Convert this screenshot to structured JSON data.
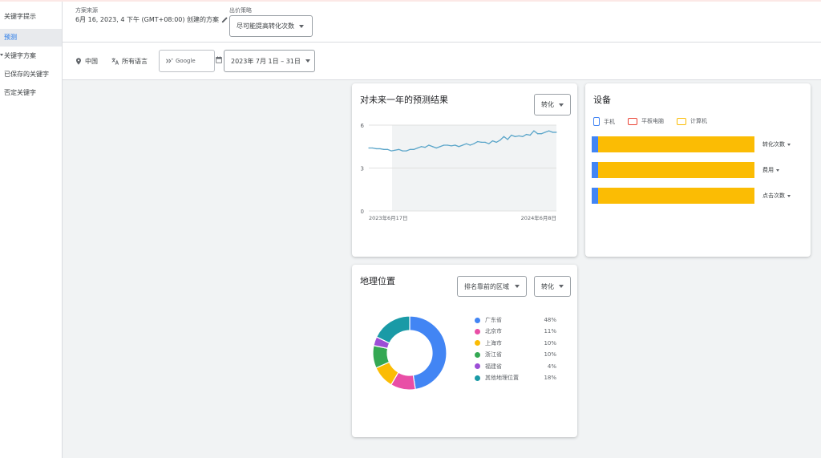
{
  "sidebar": {
    "items": [
      {
        "label": "关键字提示"
      },
      {
        "label": "预测"
      },
      {
        "label": "关键字方案"
      },
      {
        "label": "已保存的关键字"
      },
      {
        "label": "否定关键字"
      }
    ]
  },
  "plan": {
    "source_label": "方案来源",
    "created_text": "6月 16, 2023, 4 下午 (GMT+08:00) 创建的方案",
    "strategy_label": "出价策略",
    "strategy_value": "尽可能提高转化次数"
  },
  "filters": {
    "location": "中国",
    "language": "所有语言",
    "network": "Google",
    "date_range": "2023年 7月 1日 – 31日"
  },
  "forecast_card": {
    "title": "对未来一年的预测结果",
    "metric": "转化",
    "chart_data": {
      "type": "line",
      "ylim": [
        0,
        6
      ],
      "yticks": [
        "0",
        "3",
        "6"
      ],
      "x_start_label": "2023年6月17日",
      "x_end_label": "2024年6月8日",
      "values": [
        4.4,
        4.4,
        4.35,
        4.35,
        4.3,
        4.3,
        4.2,
        4.25,
        4.3,
        4.2,
        4.2,
        4.3,
        4.3,
        4.4,
        4.5,
        4.45,
        4.6,
        4.5,
        4.4,
        4.5,
        4.6,
        4.6,
        4.55,
        4.6,
        4.5,
        4.6,
        4.7,
        4.6,
        4.7,
        4.85,
        4.8,
        4.8,
        4.7,
        4.9,
        4.8,
        4.95,
        5.2,
        5.0,
        5.3,
        5.2,
        5.25,
        5.2,
        5.35,
        5.3,
        5.6,
        5.4,
        5.4,
        5.5,
        5.6,
        5.5,
        5.5
      ],
      "color": "#5aa5c9"
    }
  },
  "devices_card": {
    "title": "设备",
    "legend": [
      {
        "label": "手机",
        "color": "#4285f4"
      },
      {
        "label": "平板电脑",
        "color": "#ea4335"
      },
      {
        "label": "计算机",
        "color": "#fbbc04"
      }
    ],
    "rows": [
      {
        "metric": "转化次数",
        "mobile": 0.04,
        "tablet": 0.0,
        "computer": 0.96
      },
      {
        "metric": "费用",
        "mobile": 0.04,
        "tablet": 0.0,
        "computer": 0.96
      },
      {
        "metric": "点击次数",
        "mobile": 0.04,
        "tablet": 0.0,
        "computer": 0.96
      }
    ]
  },
  "geo_card": {
    "title": "地理位置",
    "region_dropdown": "排名靠前的区域",
    "metric_dropdown": "转化",
    "chart_data": {
      "type": "pie",
      "labels": [
        "广东省",
        "北京市",
        "上海市",
        "浙江省",
        "福建省",
        "其他地理位置"
      ],
      "values": [
        48,
        11,
        10,
        10,
        4,
        18
      ],
      "value_labels": [
        "48%",
        "11%",
        "10%",
        "10%",
        "4%",
        "18%"
      ],
      "colors": [
        "#4285f4",
        "#e94ea6",
        "#fbbc04",
        "#34a853",
        "#9c4ed6",
        "#1a9aa6"
      ]
    }
  }
}
